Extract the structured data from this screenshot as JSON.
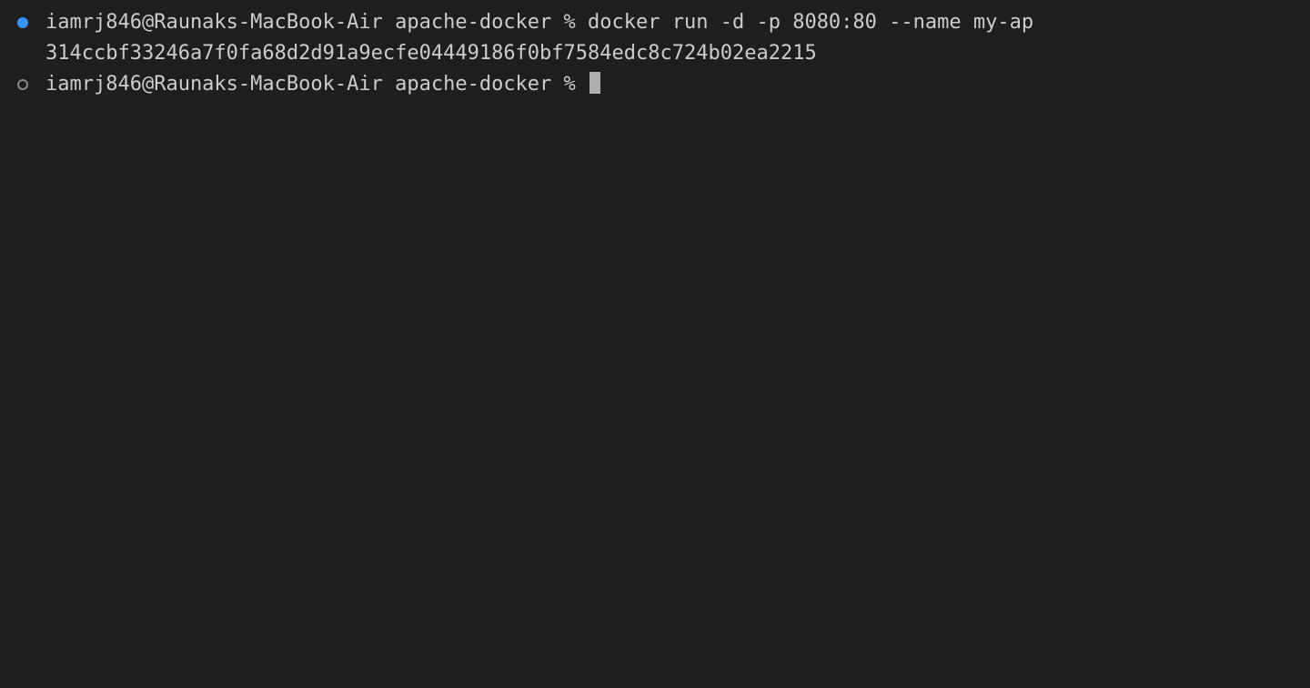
{
  "terminal": {
    "lines": [
      {
        "marker": "filled",
        "prompt": "iamrj846@Raunaks-MacBook-Air apache-docker % ",
        "command": "docker run -d -p 8080:80 --name my-ap"
      },
      {
        "output": "314ccbf33246a7f0fa68d2d91a9ecfe04449186f0bf7584edc8c724b02ea2215"
      },
      {
        "marker": "hollow",
        "prompt": "iamrj846@Raunaks-MacBook-Air apache-docker % ",
        "cursor": true
      }
    ]
  }
}
